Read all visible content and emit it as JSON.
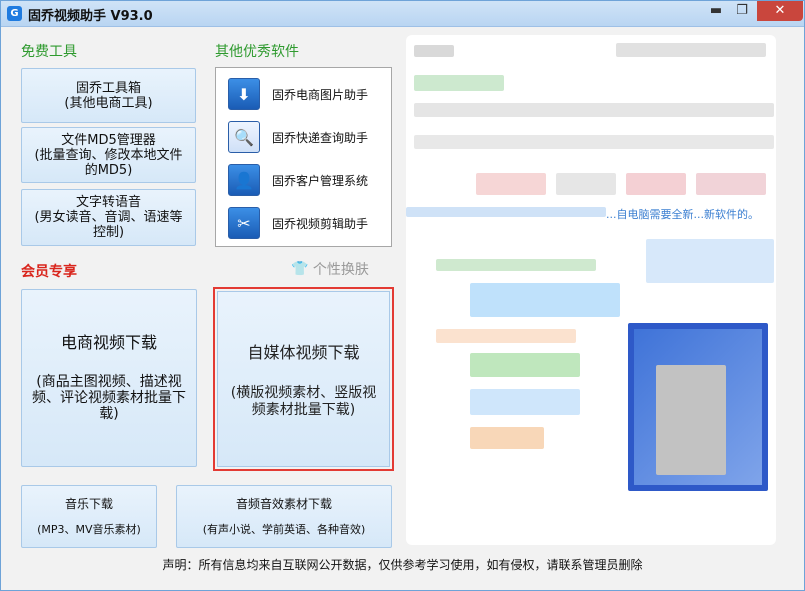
{
  "window": {
    "app_icon": "G",
    "title": "固乔视频助手 V93.0",
    "min_glyph": "▬",
    "max_glyph": "❐",
    "close_glyph": "✕"
  },
  "free_tools": {
    "title": "免费工具",
    "buttons": [
      {
        "line1": "固乔工具箱",
        "line2": "(其他电商工具)"
      },
      {
        "line1": "文件MD5管理器",
        "line2": "(批量查询、修改本地文件的MD5)"
      },
      {
        "line1": "文字转语音",
        "line2": "(男女读音、音调、语速等控制)"
      }
    ]
  },
  "other_software": {
    "title": "其他优秀软件",
    "items": [
      {
        "icon": "download-icon",
        "glyph": "⬇",
        "label": "固乔电商图片助手"
      },
      {
        "icon": "magnify-icon",
        "glyph": "🔍",
        "label": "固乔快递查询助手"
      },
      {
        "icon": "person-icon",
        "glyph": "👤",
        "label": "固乔客户管理系统"
      },
      {
        "icon": "scissors-icon",
        "glyph": "✂",
        "label": "固乔视频剪辑助手"
      }
    ]
  },
  "skin": {
    "icon": "tshirt-icon",
    "glyph": "👕",
    "label": "个性换肤"
  },
  "vip": {
    "title": "会员专享",
    "ecommerce": {
      "line1": "电商视频下载",
      "line2": "(商品主图视频、描述视频、评论视频素材批量下载)"
    },
    "media": {
      "line1": "自媒体视频下载",
      "line2": "(横版视频素材、竖版视频素材批量下载)"
    }
  },
  "bottom_buttons": {
    "music": {
      "line1": "音乐下载",
      "line2": "(MP3、MV音乐素材)"
    },
    "audio": {
      "line1": "音频音效素材下载",
      "line2": "(有声小说、学前英语、各种音效)"
    }
  },
  "ad_text": "...自电脑需要全新...新软件的。",
  "footer": "声明：所有信息均来自互联网公开数据，仅供参考学习使用，如有侵权，请联系管理员删除"
}
